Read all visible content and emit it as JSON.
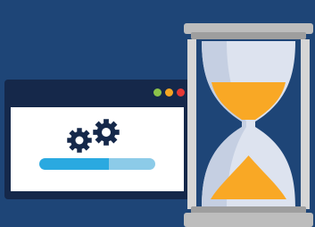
{
  "colors": {
    "background": "#1e4577",
    "window_frame": "#15284a",
    "window_content": "#ffffff",
    "dot_green": "#8bc34a",
    "dot_orange": "#f5a623",
    "dot_red": "#e53935",
    "gear": "#15284a",
    "progress_fill": "#2aa9e0",
    "progress_track": "#8ccbe8",
    "glass": "#dde3ef",
    "glass_highlight": "#c5cfe2",
    "sand": "#f9a825",
    "hourglass_cap": "#9e9e9e",
    "hourglass_cap_light": "#bdbdbd",
    "hourglass_post": "#d6d6d6"
  },
  "window": {
    "titlebar_icons": [
      "green-dot-icon",
      "orange-dot-icon",
      "red-dot-icon"
    ]
  },
  "gears": [
    "gear-icon",
    "gear-icon"
  ],
  "progress": {
    "value": 0.6
  },
  "hourglass": {
    "icon": "hourglass-icon",
    "sand_top_fraction": 0.4,
    "sand_bottom_fraction": 0.45
  }
}
